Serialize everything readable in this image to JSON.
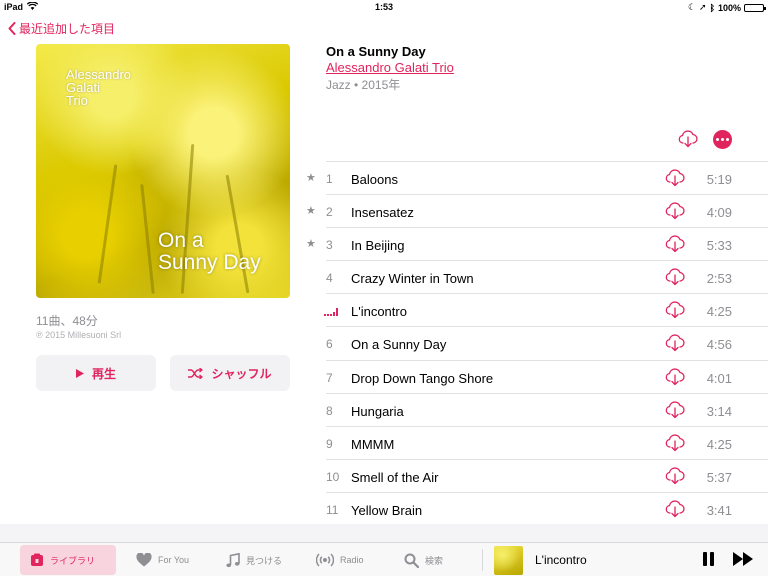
{
  "status": {
    "device": "iPad",
    "time": "1:53",
    "battery": "100%",
    "battery_level": 1.0
  },
  "nav": {
    "back_label": "最近追加した項目"
  },
  "album": {
    "art_artist_lines": [
      "Alessandro",
      "Galati",
      "Trio"
    ],
    "art_title_lines": [
      "On a",
      "Sunny Day"
    ],
    "title": "On a Sunny Day",
    "artist": "Alessandro Galati Trio",
    "genre_year": "Jazz • 2015年",
    "count_duration": "11曲、48分",
    "copyright": "℗ 2015 Millesuoni Srl",
    "play_label": "再生",
    "shuffle_label": "シャッフル"
  },
  "tracks": [
    {
      "num": "1",
      "title": "Baloons",
      "duration": "5:19",
      "starred": true,
      "playing": false
    },
    {
      "num": "2",
      "title": "Insensatez",
      "duration": "4:09",
      "starred": true,
      "playing": false
    },
    {
      "num": "3",
      "title": "In Beijing",
      "duration": "5:33",
      "starred": true,
      "playing": false
    },
    {
      "num": "4",
      "title": "Crazy Winter in Town",
      "duration": "2:53",
      "starred": false,
      "playing": false
    },
    {
      "num": "",
      "title": "L'incontro",
      "duration": "4:25",
      "starred": false,
      "playing": true
    },
    {
      "num": "6",
      "title": "On a Sunny Day",
      "duration": "4:56",
      "starred": false,
      "playing": false
    },
    {
      "num": "7",
      "title": "Drop Down Tango Shore",
      "duration": "4:01",
      "starred": false,
      "playing": false
    },
    {
      "num": "8",
      "title": "Hungaria",
      "duration": "3:14",
      "starred": false,
      "playing": false
    },
    {
      "num": "9",
      "title": "MMMM",
      "duration": "4:25",
      "starred": false,
      "playing": false
    },
    {
      "num": "10",
      "title": "Smell of the Air",
      "duration": "5:37",
      "starred": false,
      "playing": false
    },
    {
      "num": "11",
      "title": "Yellow Brain",
      "duration": "3:41",
      "starred": false,
      "playing": false
    }
  ],
  "tabs": {
    "library": "ライブラリ",
    "for_you": "For You",
    "browse": "見つける",
    "radio": "Radio",
    "search": "検索"
  },
  "now_playing": {
    "title": "L'incontro"
  },
  "colors": {
    "accent": "#e0245e"
  }
}
